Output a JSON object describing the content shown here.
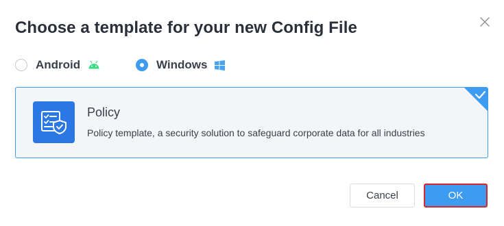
{
  "dialog": {
    "title": "Choose a template for your new Config File",
    "close_icon": "close-icon"
  },
  "platforms": {
    "android": {
      "label": "Android",
      "selected": false,
      "icon": "android-icon",
      "icon_color": "#3ddc84"
    },
    "windows": {
      "label": "Windows",
      "selected": true,
      "icon": "windows-icon",
      "icon_color": "#4aa3f0"
    }
  },
  "template": {
    "name": "Policy",
    "description": "Policy template, a security solution to safeguard corporate data for all industries",
    "icon": "policy-shield-icon",
    "selected": true
  },
  "footer": {
    "cancel_label": "Cancel",
    "ok_label": "OK"
  },
  "colors": {
    "accent": "#3d9bf0",
    "icon_bg": "#2b78e4",
    "ok_highlight_border": "#d8262c"
  }
}
